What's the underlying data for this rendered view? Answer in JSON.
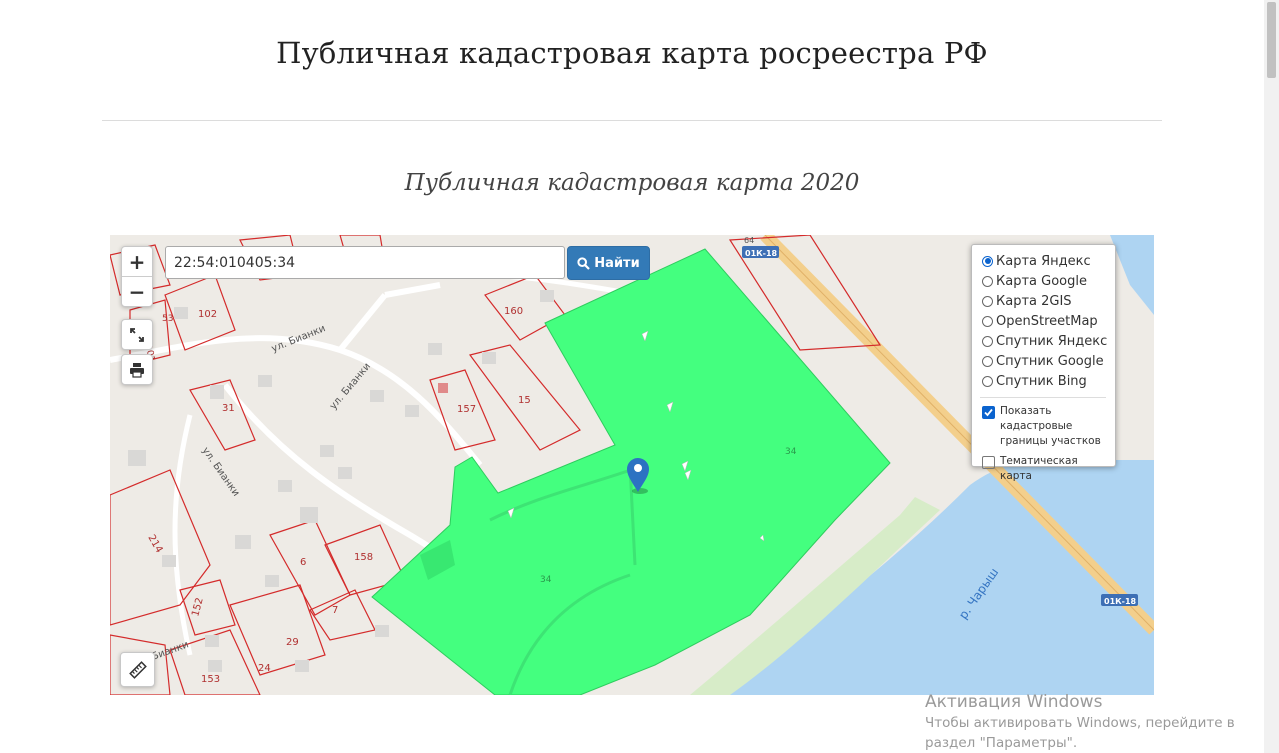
{
  "page": {
    "title": "Публичная кадастровая карта росреестра РФ",
    "subtitle": "Публичная кадастровая карта 2020"
  },
  "map": {
    "search": {
      "value": "22:54:010405:34",
      "button_label": "Найти"
    },
    "zoom": {
      "in_label": "+",
      "out_label": "−"
    },
    "icons": [
      "fullscreen-icon",
      "print-icon",
      "ruler-icon",
      "search-icon",
      "map-marker-icon"
    ],
    "layers": {
      "base_layers": [
        {
          "label": "Карта Яндекс",
          "selected": true
        },
        {
          "label": "Карта Google",
          "selected": false
        },
        {
          "label": "Карта 2GIS",
          "selected": false
        },
        {
          "label": "OpenStreetMap",
          "selected": false
        },
        {
          "label": "Спутник Яндекс",
          "selected": false
        },
        {
          "label": "Спутник Google",
          "selected": false
        },
        {
          "label": "Спутник Bing",
          "selected": false
        }
      ],
      "overlays": [
        {
          "label": "Показать кадастровые границы участков",
          "checked": true
        },
        {
          "label": "Тематическая карта",
          "checked": false
        }
      ]
    },
    "labels": {
      "street_1": "ул. Бианки",
      "street_2": "ул. Бианки",
      "street_3": "ул. Бианки",
      "street_4": "Бианки",
      "river": "р. Чарыш",
      "road_1": "01К-18",
      "road_2": "01К-18",
      "road_3": "64",
      "parcel_102": "102",
      "parcel_53": "53",
      "parcel_101": "101",
      "parcel_160": "160",
      "parcel_157": "157",
      "parcel_15": "15",
      "parcel_31": "31",
      "parcel_214": "214",
      "parcel_6": "6",
      "parcel_158": "158",
      "parcel_7": "7",
      "parcel_152": "152",
      "parcel_29": "29",
      "parcel_24": "24",
      "parcel_153": "153",
      "target_label_1": "34",
      "target_label_2": "34"
    },
    "colors": {
      "parcel_fill": "#44ff7f",
      "parcel_border": "#d42b2b",
      "water": "#aed4f2",
      "road": "#f3cf8c",
      "button": "#337ab7",
      "marker": "#2c72c2"
    }
  },
  "watermark": {
    "title": "Активация Windows",
    "text": "Чтобы активировать Windows, перейдите в раздел \"Параметры\"."
  }
}
